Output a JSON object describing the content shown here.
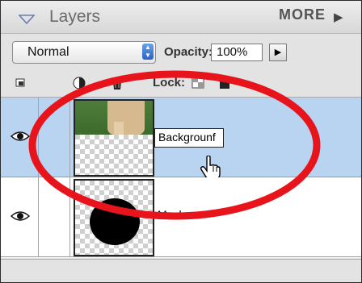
{
  "panel": {
    "title": "Layers",
    "more_label": "MORE",
    "more_arrow": "▶"
  },
  "toolbar": {
    "blend_mode": "Normal",
    "opacity_label": "Opacity:",
    "opacity_value": "100%",
    "opacity_arrow": "▶",
    "lock_label": "Lock:"
  },
  "icons": [
    "panel-collapse-icon",
    "new-layer-icon",
    "adjustment-layer-icon",
    "trash-icon",
    "lock-transparent-icon",
    "lock-all-icon",
    "eye-icon",
    "brush-icon",
    "hand-cursor-icon"
  ],
  "layers": [
    {
      "name": "Backgrounf",
      "visible": true,
      "editing": true,
      "selected": true
    },
    {
      "name": "Mask",
      "visible": true,
      "editing": false,
      "selected": false
    }
  ],
  "colors": {
    "selection": "#b9d4f1",
    "annotation": "#e8141c"
  }
}
